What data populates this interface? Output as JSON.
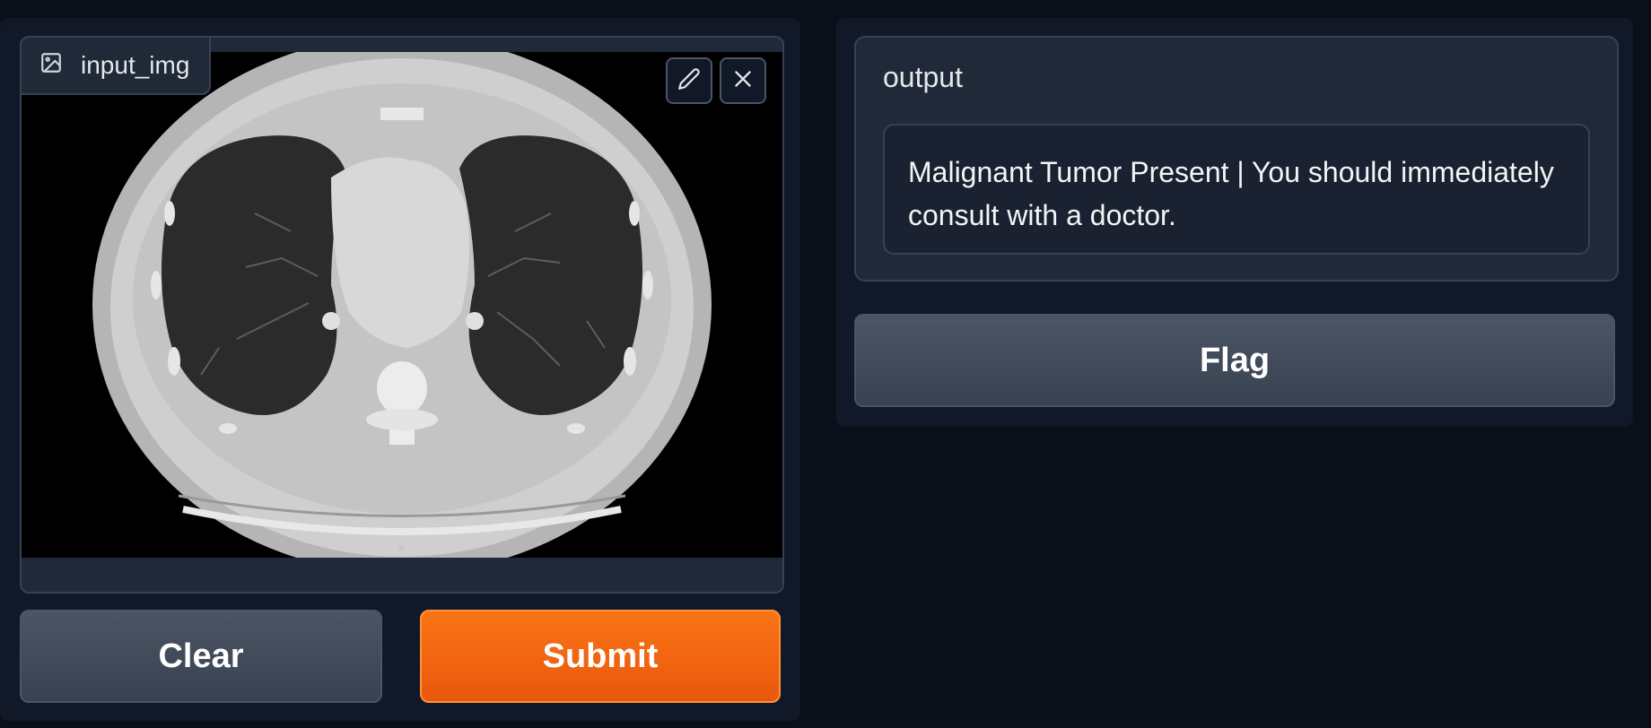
{
  "input": {
    "label": "input_img",
    "icon": "image-icon",
    "tools": [
      {
        "name": "edit",
        "icon": "pencil-icon"
      },
      {
        "name": "remove",
        "icon": "close-icon"
      }
    ],
    "image_marker": "P"
  },
  "buttons": {
    "clear": "Clear",
    "submit": "Submit",
    "flag": "Flag"
  },
  "output": {
    "label": "output",
    "value": "Malignant Tumor Present | You should immediately consult with a doctor."
  },
  "colors": {
    "background": "#0b0f19",
    "panel": "#111827",
    "primary": "#f97316",
    "secondary": "#4b5563"
  }
}
